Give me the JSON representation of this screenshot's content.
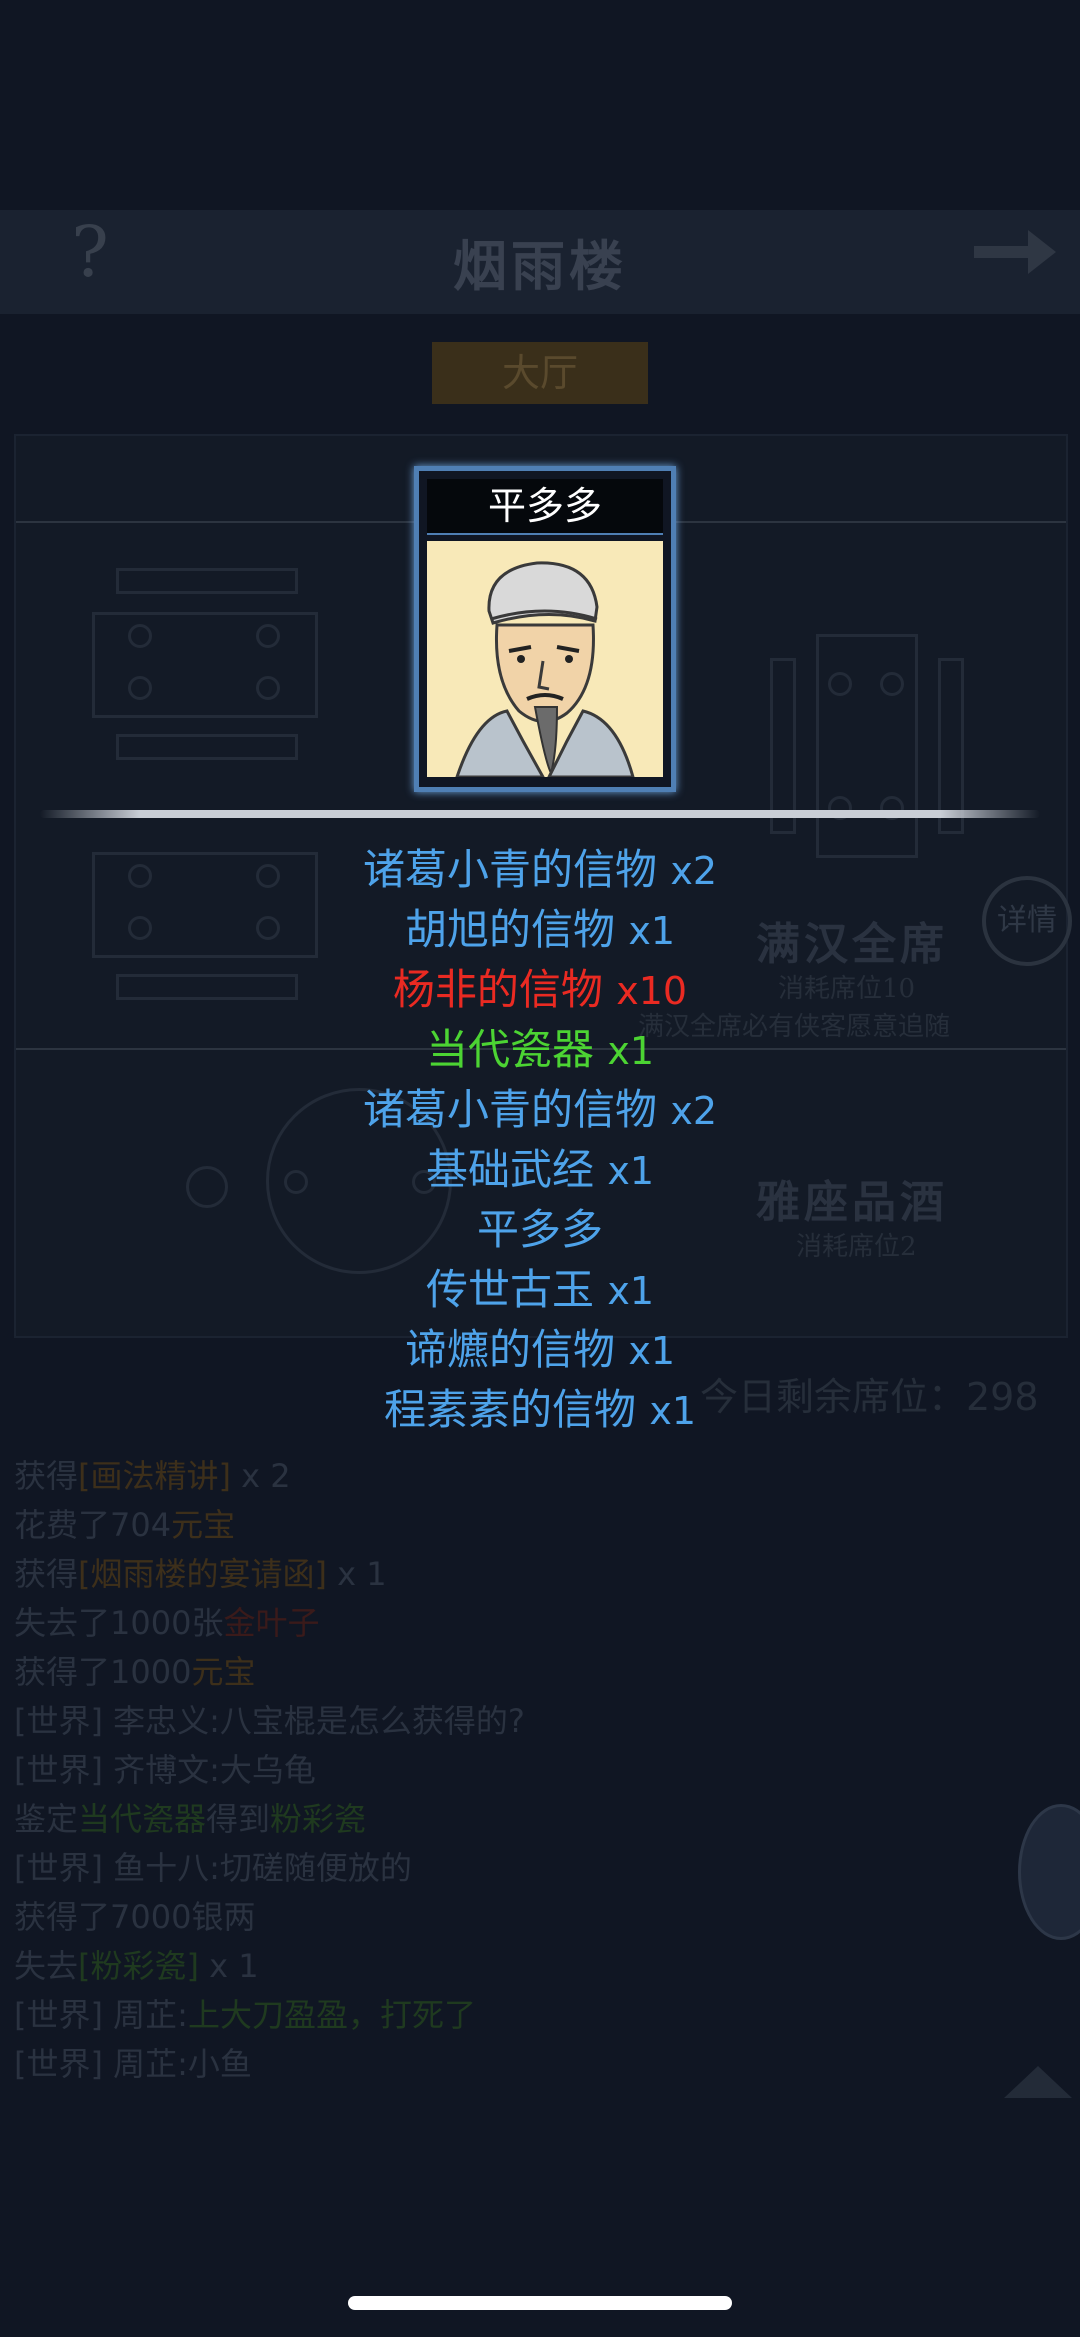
{
  "header": {
    "title": "烟雨楼",
    "help_icon": "help-icon",
    "next_icon": "arrow-right-icon"
  },
  "tab": {
    "label": "大厅"
  },
  "hall": {
    "detail_label": "详情",
    "rooms": [
      {
        "name": "满汉全席",
        "cost": "消耗席位10",
        "desc": "满汉全席必有侠客愿意追随"
      },
      {
        "name": "雅座品酒",
        "cost": "消耗席位2"
      }
    ],
    "remaining": "今日剩余席位：298"
  },
  "chat_log": [
    {
      "parts": [
        {
          "t": "获得",
          "c": ""
        },
        {
          "t": "[画法精讲]",
          "c": "gold"
        },
        {
          "t": " x 2",
          "c": ""
        }
      ]
    },
    {
      "parts": [
        {
          "t": "花费了704",
          "c": ""
        },
        {
          "t": "元宝",
          "c": "gold"
        }
      ]
    },
    {
      "parts": [
        {
          "t": "获得",
          "c": ""
        },
        {
          "t": "[烟雨楼的宴请函]",
          "c": "gold"
        },
        {
          "t": " x 1",
          "c": ""
        }
      ]
    },
    {
      "parts": [
        {
          "t": "失去了1000张",
          "c": ""
        },
        {
          "t": "金叶子",
          "c": "red"
        }
      ]
    },
    {
      "parts": [
        {
          "t": "获得了1000",
          "c": ""
        },
        {
          "t": "元宝",
          "c": "gold"
        }
      ]
    },
    {
      "parts": [
        {
          "t": "[世界] 李忠义:八宝棍是怎么获得的?",
          "c": ""
        }
      ]
    },
    {
      "parts": [
        {
          "t": "[世界] 齐博文:大乌龟",
          "c": ""
        }
      ]
    },
    {
      "parts": [
        {
          "t": "鉴定",
          "c": ""
        },
        {
          "t": "当代瓷器",
          "c": "green"
        },
        {
          "t": "得到",
          "c": ""
        },
        {
          "t": "粉彩瓷",
          "c": "green"
        }
      ]
    },
    {
      "parts": [
        {
          "t": "[世界] 鱼十八:切磋随便放的",
          "c": ""
        }
      ]
    },
    {
      "parts": [
        {
          "t": "获得了7000银两",
          "c": ""
        }
      ]
    },
    {
      "parts": [
        {
          "t": "失去",
          "c": ""
        },
        {
          "t": "[粉彩瓷]",
          "c": "green"
        },
        {
          "t": " x 1",
          "c": ""
        }
      ]
    },
    {
      "parts": [
        {
          "t": "[世界] 周芷:",
          "c": ""
        },
        {
          "t": "上大刀盈盈，打死了",
          "c": "green"
        }
      ]
    },
    {
      "parts": [
        {
          "t": "[世界] 周芷:小鱼",
          "c": ""
        }
      ]
    }
  ],
  "popup": {
    "hero_name": "平多多",
    "rewards": [
      {
        "name": "诸葛小青的信物",
        "qty": "x2",
        "color": "#4ea3ea"
      },
      {
        "name": "胡旭的信物",
        "qty": "x1",
        "color": "#4ea3ea"
      },
      {
        "name": "杨非的信物",
        "qty": "x10",
        "color": "#ea2a22"
      },
      {
        "name": "当代瓷器",
        "qty": "x1",
        "color": "#4cd433"
      },
      {
        "name": "诸葛小青的信物",
        "qty": "x2",
        "color": "#4ea3ea"
      },
      {
        "name": "基础武经",
        "qty": "x1",
        "color": "#4ea3ea"
      },
      {
        "name": "平多多",
        "qty": "",
        "color": "#4ea3ea"
      },
      {
        "name": "传世古玉",
        "qty": "x1",
        "color": "#4ea3ea"
      },
      {
        "name": "谛爊的信物",
        "qty": "x1",
        "color": "#4ea3ea"
      },
      {
        "name": "程素素的信物",
        "qty": "x1",
        "color": "#4ea3ea"
      }
    ]
  }
}
